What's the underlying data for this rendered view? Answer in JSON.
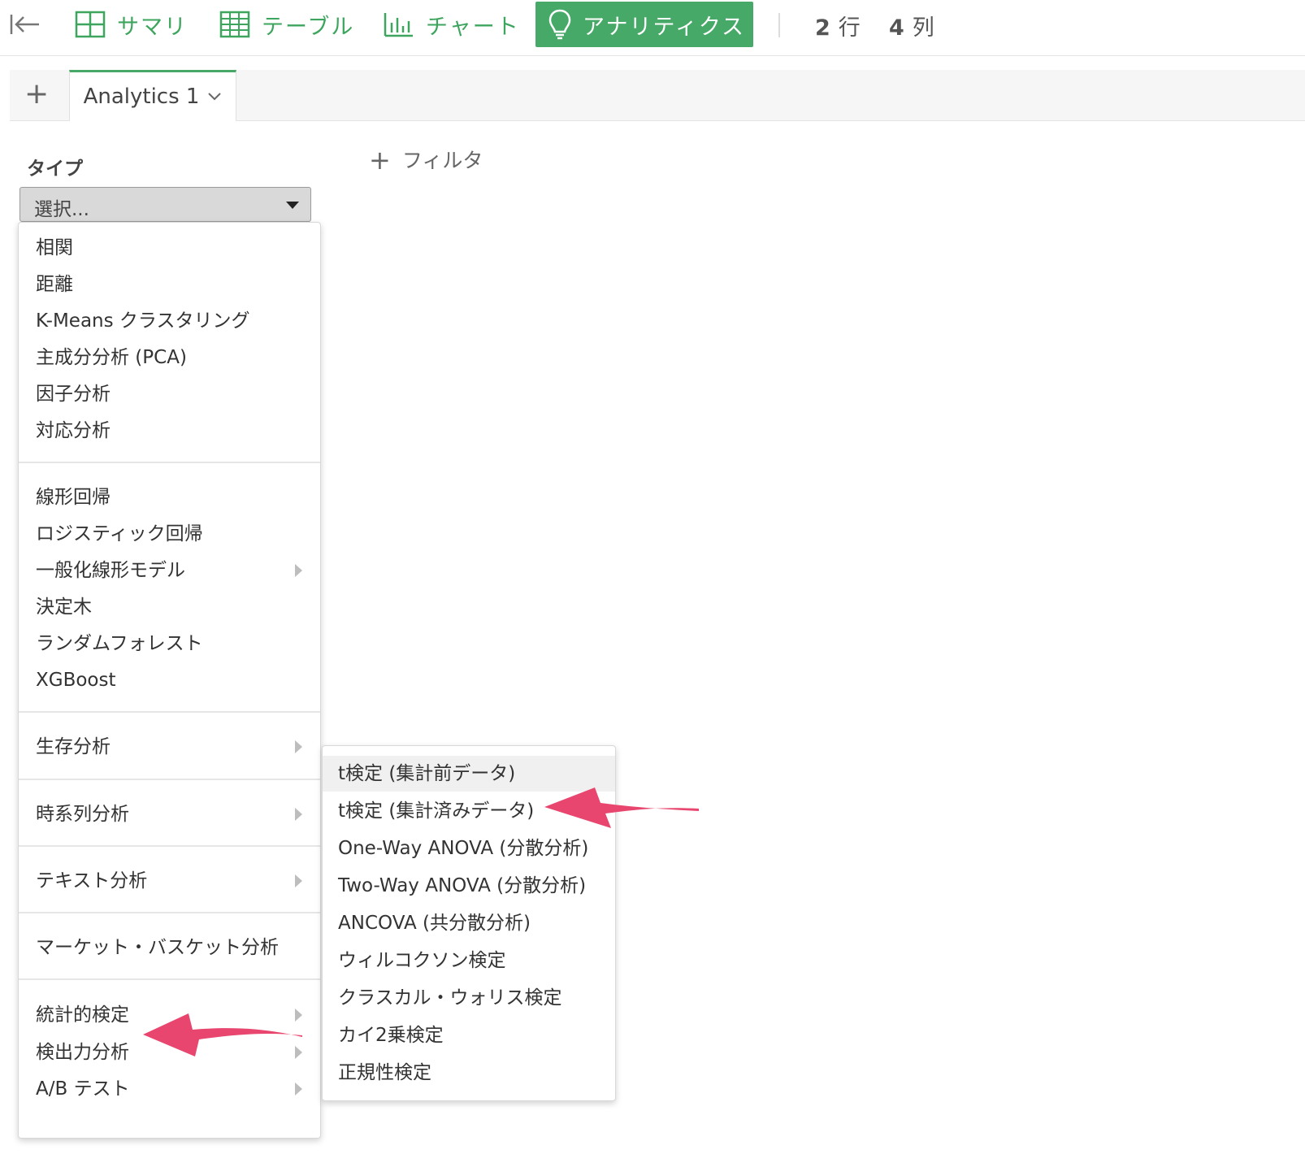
{
  "toolbar": {
    "summary_label": "サマリ",
    "table_label": "テーブル",
    "chart_label": "チャート",
    "analytics_label": "アナリティクス",
    "rows_num": "2",
    "rows_unit": "行",
    "cols_num": "4",
    "cols_unit": "列",
    "accent_color": "#46a968"
  },
  "tabs": {
    "add_label": "+",
    "active_tab_label": "Analytics 1"
  },
  "type_selector": {
    "label": "タイプ",
    "value": "選択...",
    "filter_label": "フィルタ"
  },
  "menu": {
    "items": [
      "相関",
      "距離",
      "K-Means クラスタリング",
      "主成分分析 (PCA)",
      "因子分析",
      "対応分析",
      "線形回帰",
      "ロジスティック回帰",
      "一般化線形モデル",
      "決定木",
      "ランダムフォレスト",
      "XGBoost",
      "生存分析",
      "時系列分析",
      "テキスト分析",
      "マーケット・バスケット分析",
      "統計的検定",
      "検出力分析",
      "A/B テスト"
    ]
  },
  "submenu": {
    "items": [
      "t検定 (集計前データ)",
      "t検定 (集計済みデータ)",
      "One-Way ANOVA (分散分析)",
      "Two-Way ANOVA (分散分析)",
      "ANCOVA (共分散分析)",
      "ウィルコクソン検定",
      "クラスカル・ウォリス検定",
      "カイ2乗検定",
      "正規性検定"
    ]
  },
  "annotation": {
    "arrow_color": "#e8466e"
  }
}
